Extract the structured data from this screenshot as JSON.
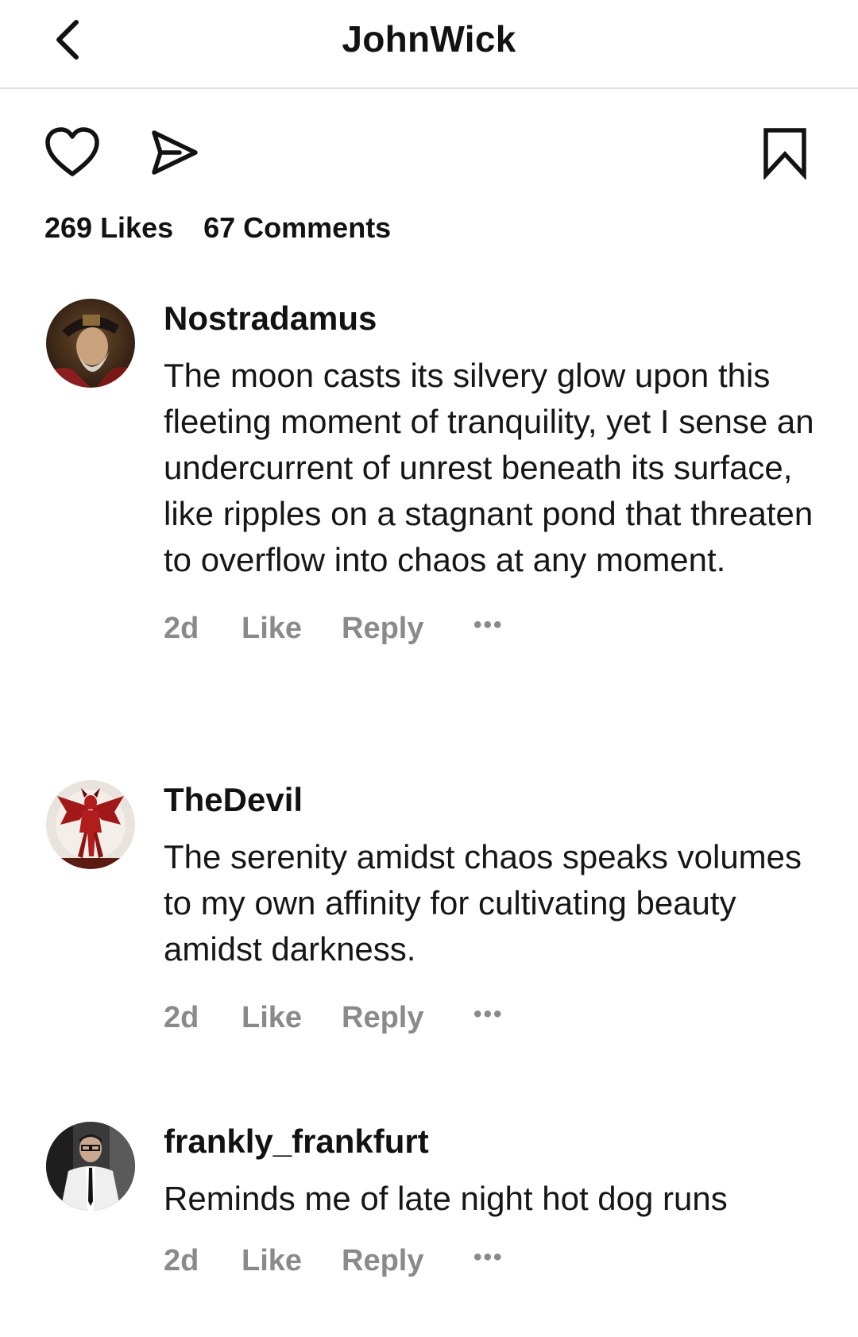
{
  "header": {
    "title": "JohnWick"
  },
  "stats": {
    "likes": "269 Likes",
    "comments": "67 Comments"
  },
  "comments": [
    {
      "user": "Nostradamus",
      "text": "The moon casts its silvery glow upon this fleeting moment of tranquility, yet I sense an undercurrent of unrest beneath its surface, like ripples on a stagnant pond that threaten to overflow into chaos at any moment.",
      "age": "2d",
      "like_label": "Like",
      "reply_label": "Reply",
      "more_label": "•••"
    },
    {
      "user": "TheDevil",
      "text": "The serenity amidst chaos speaks volumes to my own affinity for cultivating beauty amidst darkness.",
      "age": "2d",
      "like_label": "Like",
      "reply_label": "Reply",
      "more_label": "•••"
    },
    {
      "user": "frankly_frankfurt",
      "text": "Reminds me of late night hot dog runs",
      "age": "2d",
      "like_label": "Like",
      "reply_label": "Reply",
      "more_label": "•••"
    }
  ],
  "icons": {
    "back": "chevron-left-icon",
    "like": "heart-icon",
    "share": "send-icon",
    "save": "bookmark-icon"
  },
  "colors": {
    "text": "#121212",
    "meta": "#8a8a8a",
    "divider": "#e3e3e3"
  }
}
